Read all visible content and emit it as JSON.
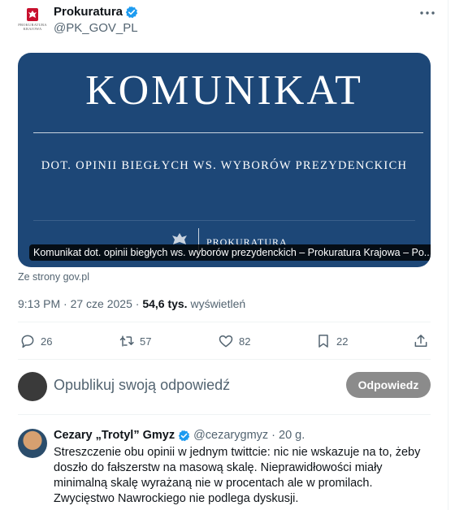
{
  "tweet": {
    "author": {
      "display_name": "Prokuratura",
      "handle": "@PK_GOV_PL",
      "avatar_text": "PROKURATURA KRAJOWA"
    },
    "card": {
      "title": "KOMUNIKAT",
      "subtitle": "DOT. OPINII BIEGŁYCH WS. WYBORÓW PREZYDENCKICH",
      "org_text": "PROKURATURA",
      "caption": "Komunikat dot. opinii biegłych ws. wyborów prezydenckich – Prokuratura Krajowa – Po..."
    },
    "source": "Ze strony gov.pl",
    "meta": {
      "time": "9:13 PM · 27 cze 2025 · ",
      "views_count": "54,6 tys.",
      "views_label": " wyświetleń"
    },
    "actions": {
      "replies": "26",
      "reposts": "57",
      "likes": "82",
      "bookmarks": "22"
    }
  },
  "compose": {
    "placeholder": "Opublikuj swoją odpowiedź",
    "button_label": "Odpowiedz"
  },
  "reply": {
    "display_name": "Cezary „Trotyl” Gmyz",
    "handle": "@cezarygmyz",
    "time": "· 20 g.",
    "text": "Streszczenie obu opinii w jednym twittcie: nic nie wskazuje na to, żeby doszło do fałszerstw na masową skalę. Nieprawidłowości miały minimalną skalę wyrażaną nie w procentach ale w promilach. Zwycięstwo Nawrockiego nie podlega dyskusji."
  },
  "colors": {
    "verified": "#1d9bf0",
    "card_bg": "#1d4777",
    "muted": "#536471",
    "button_disabled": "#8b8b8b"
  }
}
